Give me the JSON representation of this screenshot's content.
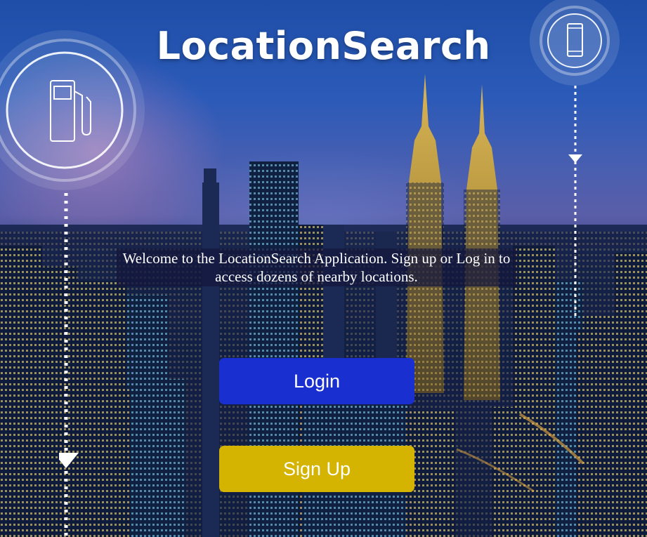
{
  "header": {
    "title": "LocationSearch"
  },
  "welcome": {
    "message": "Welcome to the LocationSearch Application. Sign up or Log in to access dozens of nearby locations."
  },
  "actions": {
    "login_label": "Login",
    "signup_label": "Sign Up"
  },
  "decor": {
    "icons": [
      "fuel-pump-icon",
      "mobile-phone-icon",
      "arrow-down-icon"
    ]
  },
  "colors": {
    "login_button": "#1a2fd0",
    "signup_button": "#d4b400",
    "text": "#ffffff"
  }
}
